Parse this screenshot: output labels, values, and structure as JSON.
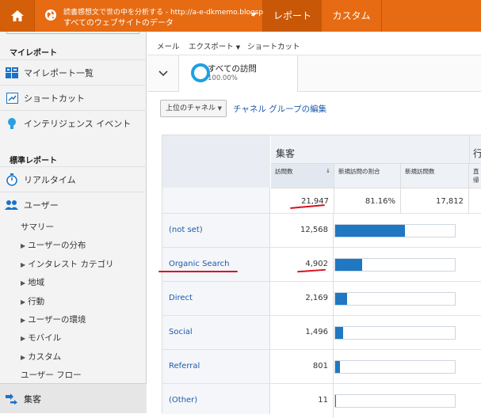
{
  "topbar": {
    "site_line1": "読書感想文で世の中を分析する - http://a-e-dkmemo.blogspo...",
    "site_line2": "すべてのウェブサイトのデータ",
    "tab_report": "レポート",
    "tab_custom": "カスタム",
    "accent": "#e66b12"
  },
  "sidebar": {
    "my_reports_head": "マイレポート",
    "items_top": [
      {
        "label": "マイレポート一覧",
        "icon": "grid-icon"
      },
      {
        "label": "ショートカット",
        "icon": "shortcut-icon"
      },
      {
        "label": "インテリジェンス イベント",
        "icon": "bulb-icon"
      }
    ],
    "std_reports_head": "標準レポート",
    "realtime": "リアルタイム",
    "users": "ユーザー",
    "users_sub": [
      {
        "label": "サマリー",
        "arrow": false
      },
      {
        "label": "ユーザーの分布",
        "arrow": true
      },
      {
        "label": "インタレスト カテゴリ",
        "arrow": true
      },
      {
        "label": "地域",
        "arrow": true
      },
      {
        "label": "行動",
        "arrow": true
      },
      {
        "label": "ユーザーの環境",
        "arrow": true
      },
      {
        "label": "モバイル",
        "arrow": true
      },
      {
        "label": "カスタム",
        "arrow": true
      },
      {
        "label": "ユーザー フロー",
        "arrow": false
      }
    ],
    "acquisition": "集客"
  },
  "toolbar": {
    "mail": "メール",
    "export": "エクスポート",
    "shortcut": "ショートカット"
  },
  "segment": {
    "name": "すべての訪問",
    "percent": "100.00%"
  },
  "dimension_select": "上位のチャネル",
  "edit_channel_group": "チャネル グループの編集",
  "table": {
    "group_acquisition": "集客",
    "group_next": "行",
    "columns": [
      "訪問数",
      "新規訪問の割合",
      "新規訪問数",
      "直帰"
    ],
    "totals": [
      "21,947",
      "81.16%",
      "17,812"
    ],
    "rows": [
      {
        "name": "(not set)",
        "visits": "12,568",
        "share": 0.5727
      },
      {
        "name": "Organic Search",
        "visits": "4,902",
        "share": 0.2234
      },
      {
        "name": "Direct",
        "visits": "2,169",
        "share": 0.0988
      },
      {
        "name": "Social",
        "visits": "1,496",
        "share": 0.0682
      },
      {
        "name": "Referral",
        "visits": "801",
        "share": 0.0365
      },
      {
        "name": "(Other)",
        "visits": "11",
        "share": 0.0005
      }
    ]
  }
}
